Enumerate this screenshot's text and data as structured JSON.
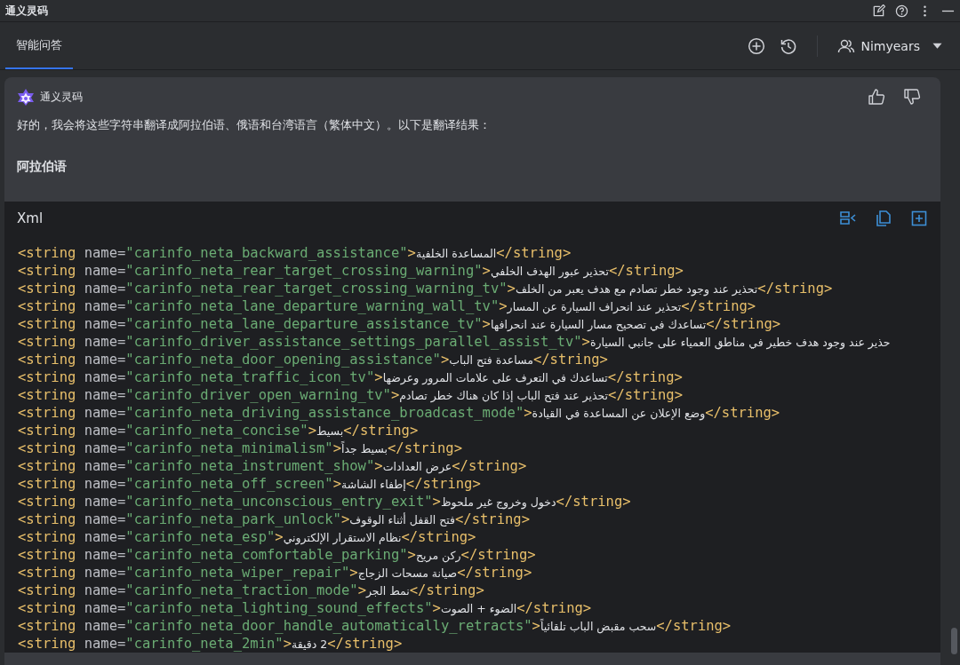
{
  "window": {
    "title": "通义灵码"
  },
  "tabs": [
    {
      "label": "智能问答",
      "selected": true
    }
  ],
  "user": {
    "name": "Nimyears"
  },
  "message": {
    "sender": "通义灵码",
    "text": "好的，我会将这些字符串翻译成阿拉伯语、俄语和台湾语言（繁体中文）。以下是翻译结果：",
    "heading": "阿拉伯语"
  },
  "code_block": {
    "language": "Xml",
    "lines": [
      {
        "open": "<string",
        "attr": " name=",
        "name": "\"carinfo_neta_backward_assistance\"",
        "gt": ">",
        "value": "المساعدة الخلفية",
        "close": "</string>"
      },
      {
        "open": "<string",
        "attr": " name=",
        "name": "\"carinfo_neta_rear_target_crossing_warning\"",
        "gt": ">",
        "value": "تحذير عبور الهدف الخلفي",
        "close": "</string>"
      },
      {
        "open": "<string",
        "attr": " name=",
        "name": "\"carinfo_neta_rear_target_crossing_warning_tv\"",
        "gt": ">",
        "value": "تحذير عند وجود خطر تصادم مع هدف يعبر من الخلف",
        "close": "</string>"
      },
      {
        "open": "<string",
        "attr": " name=",
        "name": "\"carinfo_neta_lane_departure_warning_wall_tv\"",
        "gt": ">",
        "value": "تحذير عند انحراف السيارة عن المسار",
        "close": "</string>"
      },
      {
        "open": "<string",
        "attr": " name=",
        "name": "\"carinfo_neta_lane_departure_assistance_tv\"",
        "gt": ">",
        "value": "تساعدك في تصحيح مسار السيارة عند انحرافها",
        "close": "</string>"
      },
      {
        "open": "<string",
        "attr": " name=",
        "name": "\"carinfo_driver_assistance_settings_parallel_assist_tv\"",
        "gt": ">",
        "value": "حذير عند وجود هدف خطير في مناطق العمياء على جانبي السيارة"
      },
      {
        "open": "<string",
        "attr": " name=",
        "name": "\"carinfo_neta_door_opening_assistance\"",
        "gt": ">",
        "value": "مساعدة فتح الباب",
        "close": "</string>"
      },
      {
        "open": "<string",
        "attr": " name=",
        "name": "\"carinfo_neta_traffic_icon_tv\"",
        "gt": ">",
        "value": "تساعدك في التعرف على علامات المرور وعرضها",
        "close": "</string>"
      },
      {
        "open": "<string",
        "attr": " name=",
        "name": "\"carinfo_driver_open_warning_tv\"",
        "gt": ">",
        "value": "تحذير عند فتح الباب إذا كان هناك خطر تصادم",
        "close": "</string>"
      },
      {
        "open": "<string",
        "attr": " name=",
        "name": "\"carinfo_neta_driving_assistance_broadcast_mode\"",
        "gt": ">",
        "value": "وضع الإعلان عن المساعدة في القيادة",
        "close": "</string>"
      },
      {
        "open": "<string",
        "attr": " name=",
        "name": "\"carinfo_neta_concise\"",
        "gt": ">",
        "value": "بسيط",
        "close": "</string>"
      },
      {
        "open": "<string",
        "attr": " name=",
        "name": "\"carinfo_neta_minimalism\"",
        "gt": ">",
        "value": "بسيط جداً",
        "close": "</string>"
      },
      {
        "open": "<string",
        "attr": " name=",
        "name": "\"carinfo_neta_instrument_show\"",
        "gt": ">",
        "value": "عرض العدادات",
        "close": "</string>"
      },
      {
        "open": "<string",
        "attr": " name=",
        "name": "\"carinfo_neta_off_screen\"",
        "gt": ">",
        "value": "إطفاء الشاشة",
        "close": "</string>"
      },
      {
        "open": "<string",
        "attr": " name=",
        "name": "\"carinfo_neta_unconscious_entry_exit\"",
        "gt": ">",
        "value": "دخول وخروج غير ملحوظ",
        "close": "</string>"
      },
      {
        "open": "<string",
        "attr": " name=",
        "name": "\"carinfo_neta_park_unlock\"",
        "gt": ">",
        "value": "فتح القفل أثناء الوقوف",
        "close": "</string>"
      },
      {
        "open": "<string",
        "attr": " name=",
        "name": "\"carinfo_neta_esp\"",
        "gt": ">",
        "value": "نظام الاستقرار الإلكتروني",
        "close": "</string>"
      },
      {
        "open": "<string",
        "attr": " name=",
        "name": "\"carinfo_neta_comfortable_parking\"",
        "gt": ">",
        "value": "ركن مريح",
        "close": "</string>"
      },
      {
        "open": "<string",
        "attr": " name=",
        "name": "\"carinfo_neta_wiper_repair\"",
        "gt": ">",
        "value": "صيانة مسحات الزجاج",
        "close": "</string>"
      },
      {
        "open": "<string",
        "attr": " name=",
        "name": "\"carinfo_neta_traction_mode\"",
        "gt": ">",
        "value": "نمط الجر",
        "close": "</string>"
      },
      {
        "open": "<string",
        "attr": " name=",
        "name": "\"carinfo_neta_lighting_sound_effects\"",
        "gt": ">",
        "value": "الضوء + الصوت",
        "close": "</string>"
      },
      {
        "open": "<string",
        "attr": " name=",
        "name": "\"carinfo_neta_door_handle_automatically_retracts\"",
        "gt": ">",
        "value": "سحب مقبض الباب تلقائياً",
        "close": "</string>"
      },
      {
        "open": "<string",
        "attr": " name=",
        "name": "\"carinfo_neta_2min\"",
        "gt": ">",
        "value": "2 دقيقة",
        "close": "</string>"
      }
    ]
  }
}
